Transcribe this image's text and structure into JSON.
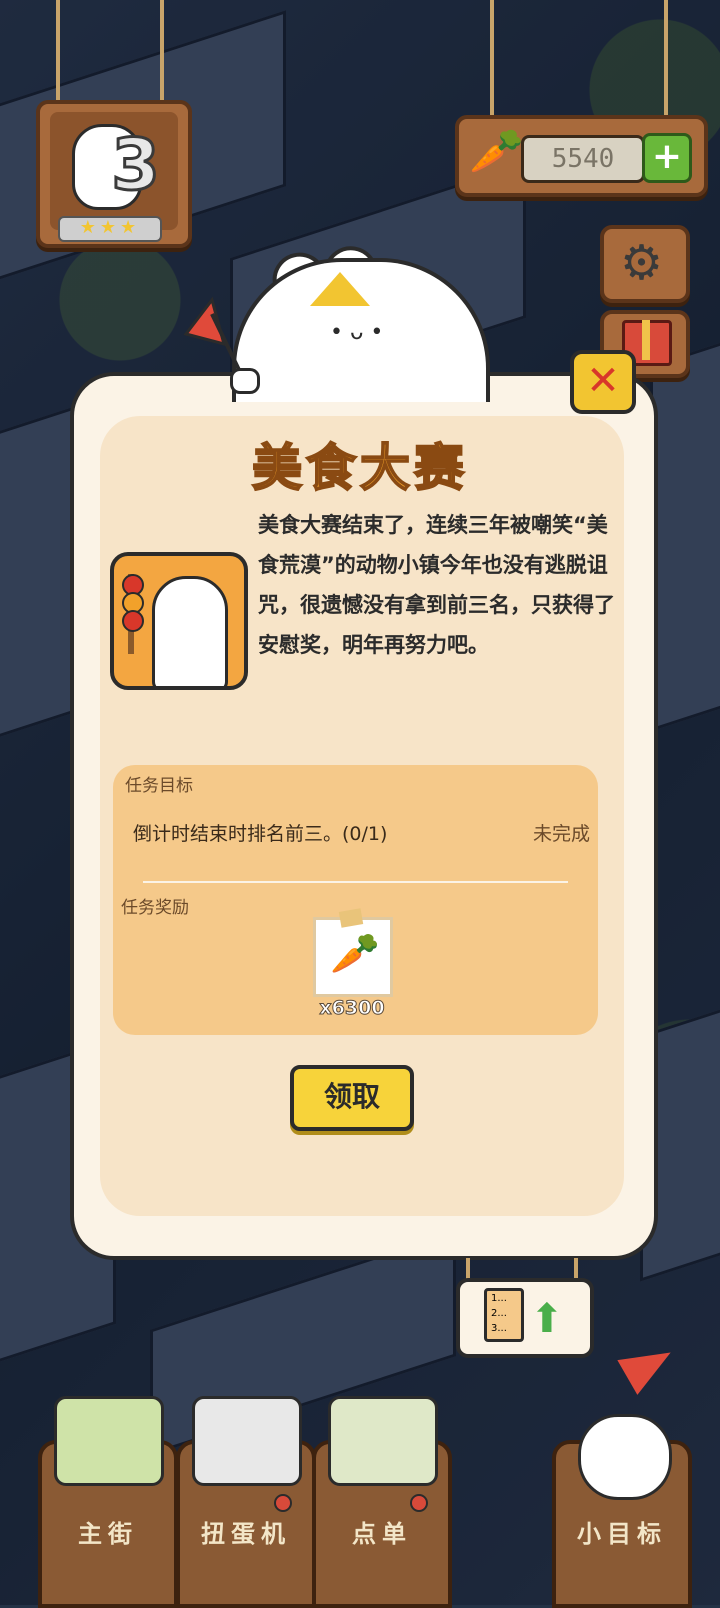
{
  "hud": {
    "level_number": "3",
    "level_stars": "★★★",
    "carrot_count": "5540",
    "plus_symbol": "+"
  },
  "modal": {
    "title": "美食大赛",
    "story_text": "美食大赛结束了，连续三年被嘲笑“美食荒漠”的动物小镇今年也没有逃脱诅咒，很遗憾没有拿到前三名，只获得了安慰奖，明年再努力吧。",
    "close_symbol": "✕",
    "task": {
      "goal_header": "任务目标",
      "goal_text": "倒计时结束时排名前三。(0/1)",
      "goal_status": "未完成",
      "reward_header": "任务奖励",
      "reward_icon": "carrot-icon",
      "reward_quantity": "x6300"
    },
    "claim_label": "领取"
  },
  "colors": {
    "title_orange": "#f2a12a",
    "claim_yellow": "#f7d33a",
    "panel_peach": "#f5c98a",
    "modal_cream": "#fbf3e6"
  },
  "dock": {
    "items": [
      {
        "label": "主街",
        "icon": "map-icon"
      },
      {
        "label": "扭蛋机",
        "icon": "gacha-machine-icon"
      },
      {
        "label": "点单",
        "icon": "order-list-icon"
      },
      {
        "label": "小目标",
        "icon": "rabbit-paw-icon"
      }
    ]
  }
}
